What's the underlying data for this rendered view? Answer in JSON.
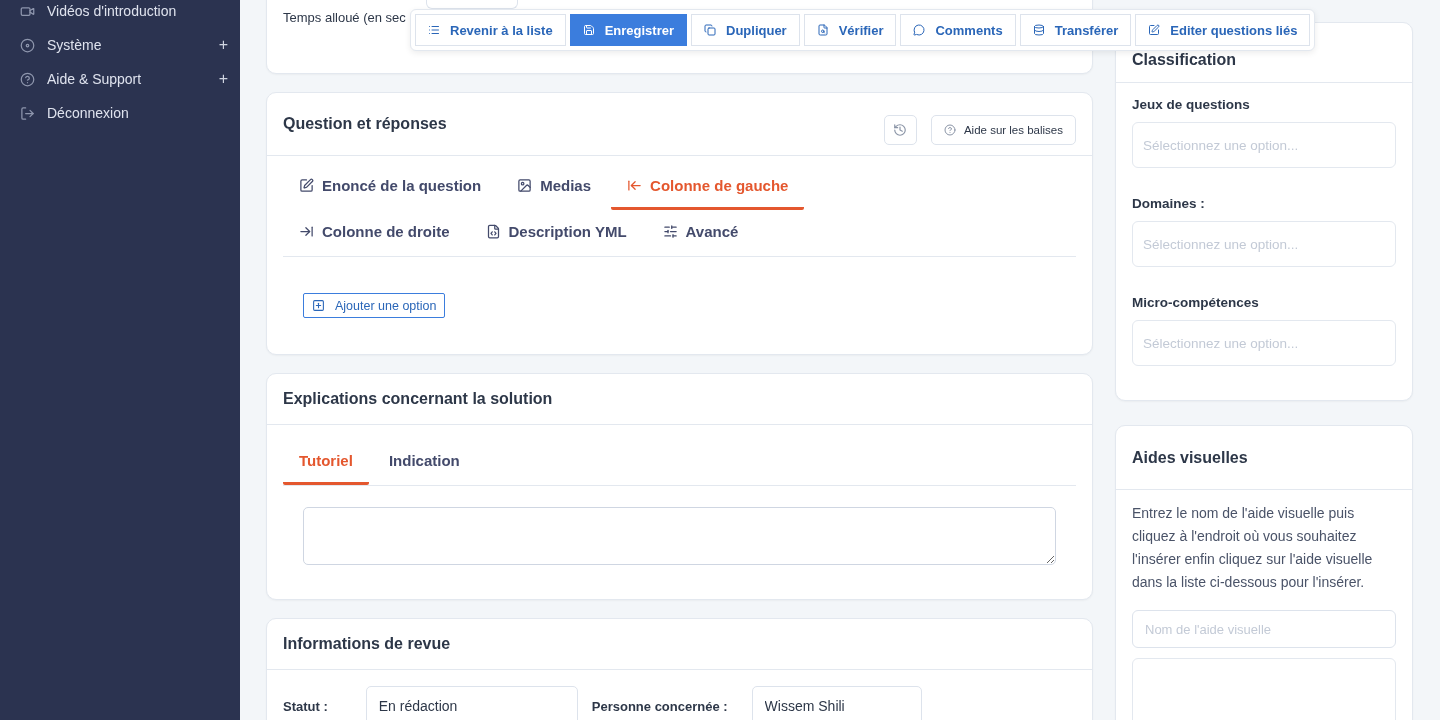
{
  "sidebar": {
    "items": [
      {
        "label": "Vidéos d'introduction"
      },
      {
        "label": "Système",
        "expand_mark": "+"
      },
      {
        "label": "Aide & Support",
        "expand_mark": "+"
      },
      {
        "label": "Déconnexion"
      }
    ]
  },
  "toolbar": {
    "buttons": [
      {
        "label": "Revenir à la liste",
        "primary": false
      },
      {
        "label": "Enregistrer",
        "primary": true
      },
      {
        "label": "Dupliquer",
        "primary": false
      },
      {
        "label": "Vérifier",
        "primary": false
      },
      {
        "label": "Comments",
        "primary": false
      },
      {
        "label": "Transférer",
        "primary": false
      },
      {
        "label": "Editer questions liés",
        "primary": false
      }
    ]
  },
  "time_card": {
    "label": "Temps alloué (en sec"
  },
  "question_card": {
    "title": "Question et réponses",
    "help_button": "Aide sur les balises",
    "tabs": [
      {
        "label": "Enoncé de la question",
        "selected": false
      },
      {
        "label": "Medias",
        "selected": false
      },
      {
        "label": "Colonne de gauche",
        "selected": true
      },
      {
        "label": "Colonne de droite",
        "selected": false
      },
      {
        "label": "Description YML",
        "selected": false
      },
      {
        "label": "Avancé",
        "selected": false
      }
    ],
    "add_option": "Ajouter une option"
  },
  "explanation_card": {
    "title": "Explications concernant la solution",
    "tabs": [
      {
        "label": "Tutoriel",
        "selected": true
      },
      {
        "label": "Indication",
        "selected": false
      }
    ]
  },
  "review_card": {
    "title": "Informations de revue",
    "fields": [
      {
        "label": "Statut :",
        "value": "En rédaction"
      },
      {
        "label": "Personne concernée :",
        "value": "Wissem Shili"
      }
    ]
  },
  "classification_card": {
    "title": "Classification",
    "fields": [
      {
        "label": "Jeux de questions",
        "placeholder": "Sélectionnez une option..."
      },
      {
        "label": "Domaines :",
        "placeholder": "Sélectionnez une option..."
      },
      {
        "label": "Micro-compétences",
        "placeholder": "Sélectionnez une option..."
      }
    ]
  },
  "visual_aids_card": {
    "title": "Aides visuelles",
    "instructions": "Entrez le nom de l'aide visuelle puis cliquez à l'endroit où vous souhaitez l'insérer enfin cliquez sur l'aide visuelle dans la liste ci-dessous pour l'insérer.",
    "name_placeholder": "Nom de l'aide visuelle"
  }
}
